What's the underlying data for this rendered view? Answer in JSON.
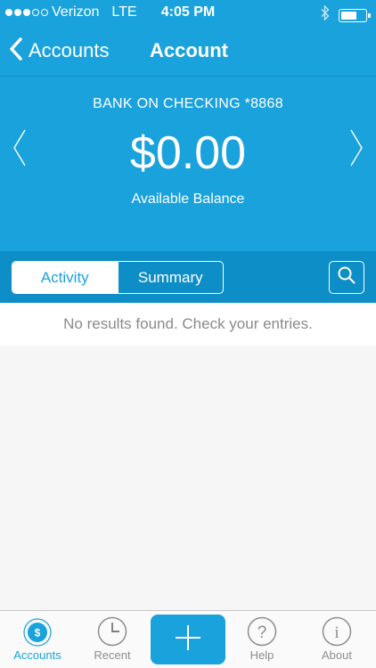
{
  "status_bar": {
    "carrier": "Verizon",
    "network": "LTE",
    "time": "4:05 PM",
    "signal_bars_filled": 3,
    "signal_bars_total": 5
  },
  "nav": {
    "back_label": "Accounts",
    "title": "Account"
  },
  "account": {
    "name": "BANK ON CHECKING *8868",
    "balance": "$0.00",
    "balance_label": "Available Balance"
  },
  "segments": {
    "activity_label": "Activity",
    "summary_label": "Summary",
    "selected": "Activity"
  },
  "results": {
    "message": "No results found. Check your entries."
  },
  "tab_bar": {
    "items": [
      {
        "label": "Accounts",
        "icon": "dollar-icon",
        "active": true
      },
      {
        "label": "Recent",
        "icon": "clock-icon",
        "active": false
      },
      {
        "label": "",
        "icon": "plus-icon",
        "active": false
      },
      {
        "label": "Help",
        "icon": "question-icon",
        "active": false
      },
      {
        "label": "About",
        "icon": "info-icon",
        "active": false
      }
    ]
  },
  "colors": {
    "brand": "#1aa2dc",
    "segment_bar": "#0e8ec7",
    "background": "#f6f6f6",
    "inactive_tab": "#8e8e93"
  }
}
